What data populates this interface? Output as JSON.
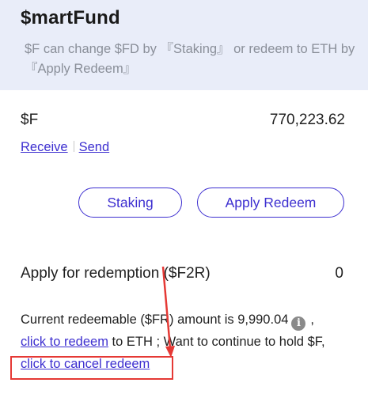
{
  "app": {
    "title": "$martFund",
    "description": "$F can change $FD by 『Staking』 or redeem to ETH by 『Apply Redeem』"
  },
  "token": {
    "symbol": "$F",
    "balance": "770,223.62",
    "receive_label": "Receive",
    "send_label": "Send"
  },
  "actions": {
    "staking_label": "Staking",
    "apply_redeem_label": "Apply Redeem"
  },
  "redemption": {
    "label": "Apply for redemption ($F2R)",
    "value": "0"
  },
  "info": {
    "redeemable_text": "Current redeemable ($FR) amount is 9,990.04",
    "after_icon": ",",
    "click_redeem_label": "click to redeem",
    "to_eth_text": " to ETH ; Want to continue to hold $F,",
    "click_cancel_label": "click to cancel redeem"
  },
  "annotation": {
    "highlight_color": "#e53935",
    "icon": "info-icon"
  },
  "colors": {
    "accent": "#3d2fd0",
    "header_bg": "#e9edf9"
  }
}
